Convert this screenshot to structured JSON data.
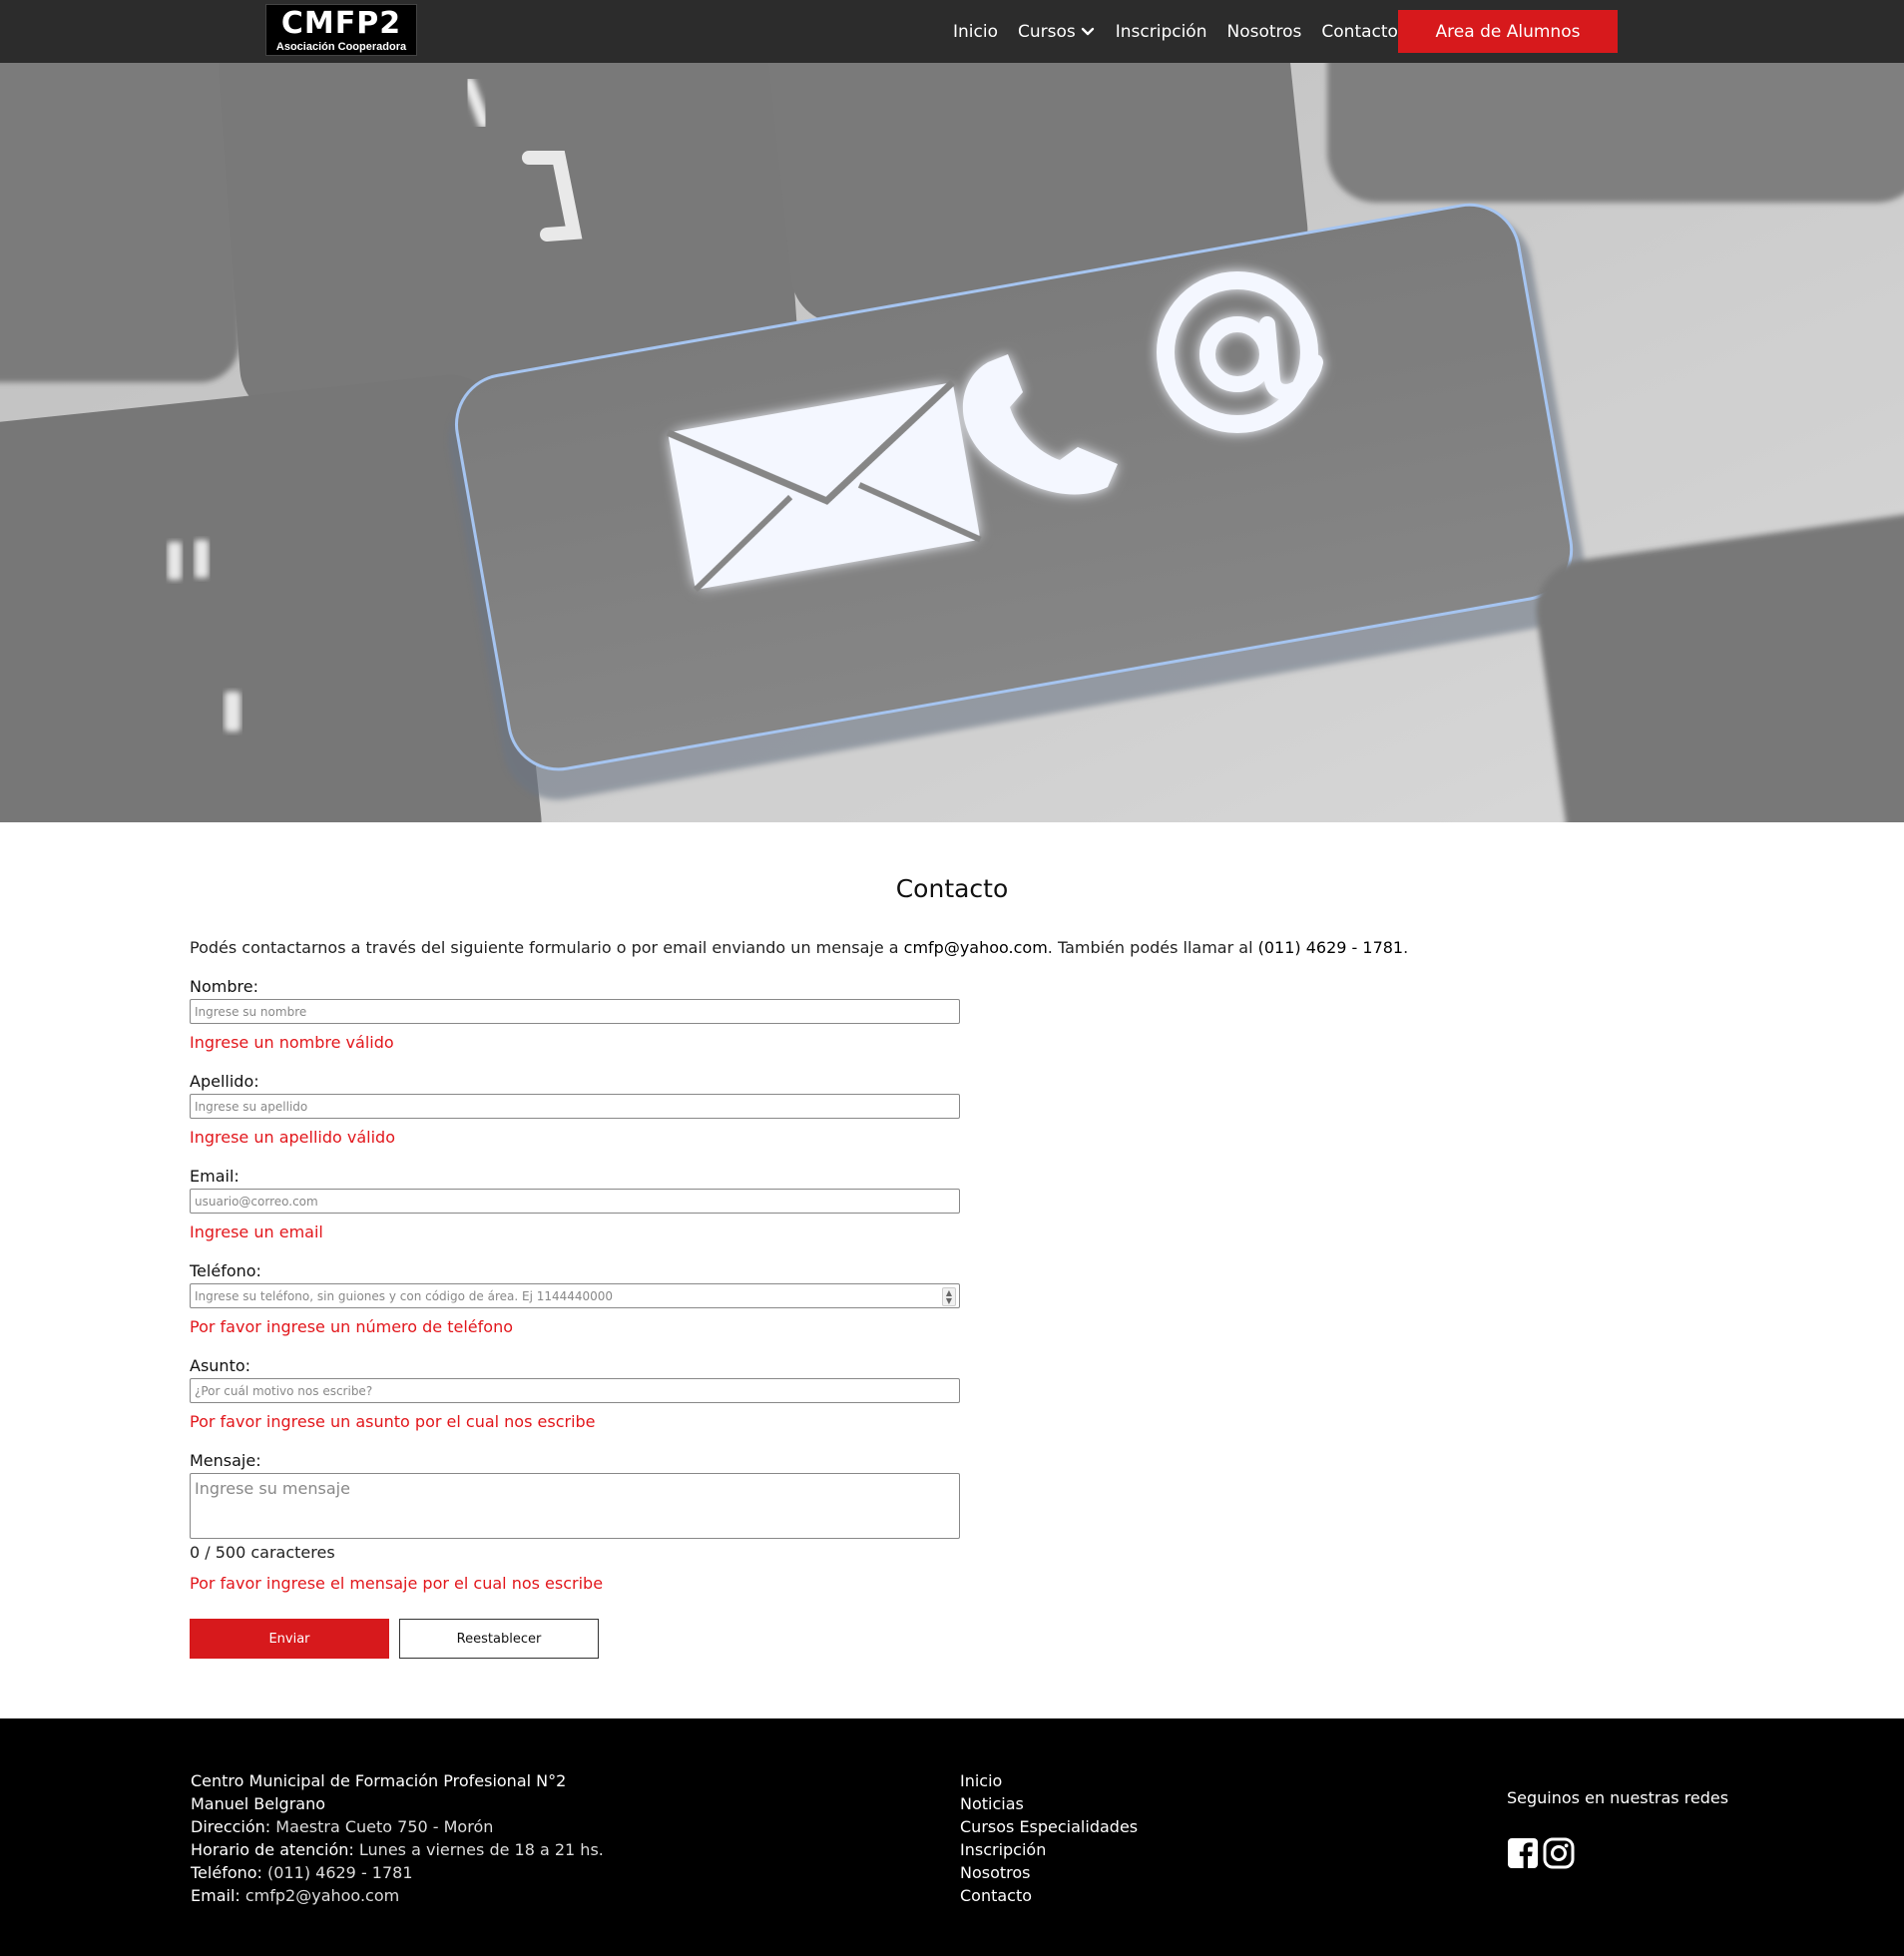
{
  "header": {
    "logo_text": "CMFP2",
    "logo_subtitle": "Asociación Cooperadora",
    "nav": [
      {
        "label": "Inicio"
      },
      {
        "label": "Cursos",
        "has_dropdown": true
      },
      {
        "label": "Inscripción"
      },
      {
        "label": "Nosotros"
      },
      {
        "label": "Contacto"
      }
    ],
    "cta_label": "Area de Alumnos",
    "accent_color": "#d7191c"
  },
  "hero": {
    "image_icons": [
      "mail-icon",
      "phone-icon",
      "at-sign-icon"
    ]
  },
  "main": {
    "title": "Contacto",
    "intro": {
      "text_1": "Podés contactarnos a través del siguiente formulario o por email enviando un mensaje a ",
      "email": "cmfp@yahoo.com",
      "text_2": ". También podés llamar al ",
      "phone": "(011) 4629 - 1781",
      "text_3": "."
    },
    "form": {
      "nombre": {
        "label": "Nombre:",
        "placeholder": "Ingrese su nombre",
        "value": "",
        "error": "Ingrese un nombre válido"
      },
      "apellido": {
        "label": "Apellido:",
        "placeholder": "Ingrese su apellido",
        "value": "",
        "error": "Ingrese un apellido válido"
      },
      "email": {
        "label": "Email:",
        "placeholder": "usuario@correo.com",
        "value": "",
        "error": "Ingrese un email"
      },
      "telefono": {
        "label": "Teléfono:",
        "placeholder": "Ingrese su teléfono, sin guiones y con código de área. Ej 1144440000",
        "value": "",
        "error": "Por favor ingrese un número de teléfono"
      },
      "asunto": {
        "label": "Asunto:",
        "placeholder": "¿Por cuál motivo nos escribe?",
        "value": "",
        "error": "Por favor ingrese un asunto por el cual nos escribe"
      },
      "mensaje": {
        "label": "Mensaje:",
        "placeholder": "Ingrese su mensaje",
        "value": "",
        "counter": "0 / 500 caracteres",
        "error": "Por favor ingrese el mensaje por el cual nos escribe"
      },
      "submit_label": "Enviar",
      "reset_label": "Reestablecer"
    }
  },
  "footer": {
    "org_line1": "Centro Municipal de Formación Profesional N°2",
    "org_line2": "Manuel Belgrano",
    "direccion_label": "Dirección:",
    "direccion": "Maestra Cueto 750 - Morón",
    "horario_label": "Horario de atención:",
    "horario": "Lunes a viernes de 18 a 21 hs.",
    "telefono_label": "Teléfono:",
    "telefono": "(011) 4629 - 1781",
    "email_label": "Email:",
    "email": "cmfp2@yahoo.com",
    "links": [
      "Inicio",
      "Noticias",
      "Cursos Especialidades",
      "Inscripción",
      "Nosotros",
      "Contacto"
    ],
    "social_title": "Seguinos en nuestras redes",
    "social_icons": [
      "facebook-icon",
      "instagram-icon"
    ]
  }
}
